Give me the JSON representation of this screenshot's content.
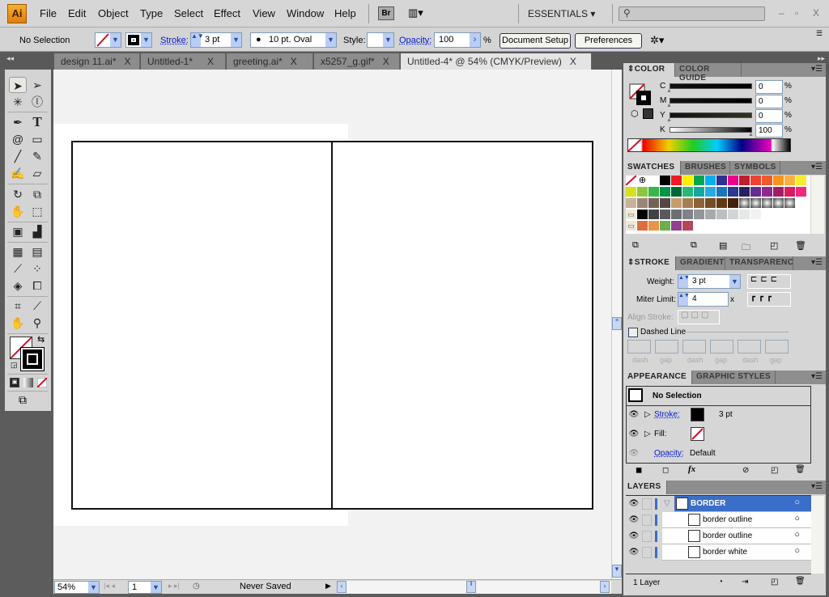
{
  "app": {
    "logo": "Ai",
    "workspace": "ESSENTIALS",
    "bridge": "Br",
    "window_controls": [
      "–",
      "▫",
      "X"
    ]
  },
  "menu": [
    "File",
    "Edit",
    "Object",
    "Type",
    "Select",
    "Effect",
    "View",
    "Window",
    "Help"
  ],
  "control": {
    "selection": "No Selection",
    "stroke_label": "Stroke:",
    "stroke_weight": "3 pt",
    "brush": "10 pt. Oval",
    "style_label": "Style:",
    "opacity_label": "Opacity:",
    "opacity": "100",
    "percent": "%",
    "document_setup": "Document Setup",
    "preferences": "Preferences"
  },
  "tabs": [
    {
      "label": "design 11.ai*",
      "close": "X"
    },
    {
      "label": "Untitled-1*",
      "close": "X"
    },
    {
      "label": "greeting.ai*",
      "close": "X"
    },
    {
      "label": "x5257_g.gif*",
      "close": "X"
    },
    {
      "label": "Untitled-4* @ 54% (CMYK/Preview)",
      "close": "X",
      "active": true
    }
  ],
  "status": {
    "zoom": "54%",
    "page": "1",
    "save_state": "Never Saved"
  },
  "color_panel": {
    "tabs": [
      "COLOR",
      "COLOR GUIDE"
    ],
    "channels": [
      {
        "name": "C",
        "value": "0",
        "color": "#00aeef"
      },
      {
        "name": "M",
        "value": "0",
        "color": "#ec008c"
      },
      {
        "name": "Y",
        "value": "0",
        "color": "#fff200"
      },
      {
        "name": "K",
        "value": "100",
        "color": "#000000"
      }
    ],
    "unit": "%"
  },
  "swatches_panel": {
    "tabs": [
      "SWATCHES",
      "BRUSHES",
      "SYMBOLS"
    ],
    "rows": [
      [
        "none",
        "registration",
        "#ffffff",
        "#000000",
        "#ed1c24",
        "#fff200",
        "#00a651",
        "#00aeef",
        "#2e3192",
        "#ec008c",
        "#be1e2d",
        "#ef4136",
        "#f15a29",
        "#f7941d",
        "#fbb040",
        "#f9ed32"
      ],
      [
        "#d7e021",
        "#8dc63f",
        "#39b54a",
        "#009444",
        "#006838",
        "#2bb673",
        "#13a89e",
        "#27aae1",
        "#1c75bc",
        "#2b3990",
        "#262262",
        "#662d91",
        "#92278f",
        "#9e1f63",
        "#da1c5c",
        "#ee2a7b"
      ],
      [
        "#c7b299",
        "#998675",
        "#736357",
        "#534741",
        "#c69c6d",
        "#a67c52",
        "#8c6239",
        "#754c24",
        "#603913",
        "#42210b",
        "pattern",
        "pattern",
        "pattern",
        "pattern",
        "pattern"
      ],
      [
        "folder",
        "#000000",
        "#414042",
        "#58595b",
        "#6d6e71",
        "#808285",
        "#939598",
        "#a7a9ac",
        "#bcbec0",
        "#d1d3d4",
        "#e6e7e8",
        "#f1f2f2"
      ],
      [
        "folder",
        "#e06c3f",
        "#e8944a",
        "#6ab04c",
        "#92408f",
        "#b5465a"
      ]
    ]
  },
  "stroke_panel": {
    "tabs": [
      "STROKE",
      "GRADIENT",
      "TRANSPARENC"
    ],
    "weight_label": "Weight:",
    "weight": "3 pt",
    "miter_label": "Miter Limit:",
    "miter": "4",
    "miter_unit": "x",
    "align_label": "Align Stroke:",
    "dashed_label": "Dashed Line",
    "dash_labels": [
      "dash",
      "gap",
      "dash",
      "gap",
      "dash",
      "gap"
    ]
  },
  "appearance_panel": {
    "tabs": [
      "APPEARANCE",
      "GRAPHIC STYLES"
    ],
    "title": "No Selection",
    "stroke_label": "Stroke:",
    "stroke_value": "3 pt",
    "fill_label": "Fill:",
    "opacity_label": "Opacity:",
    "opacity_value": "Default"
  },
  "layers_panel": {
    "tabs": [
      "LAYERS"
    ],
    "layers": [
      {
        "name": "BORDER",
        "selected": true
      },
      {
        "name": "border outline"
      },
      {
        "name": "border outline"
      },
      {
        "name": "border white"
      }
    ],
    "count": "1 Layer",
    "accent": "#3a6ec8"
  }
}
